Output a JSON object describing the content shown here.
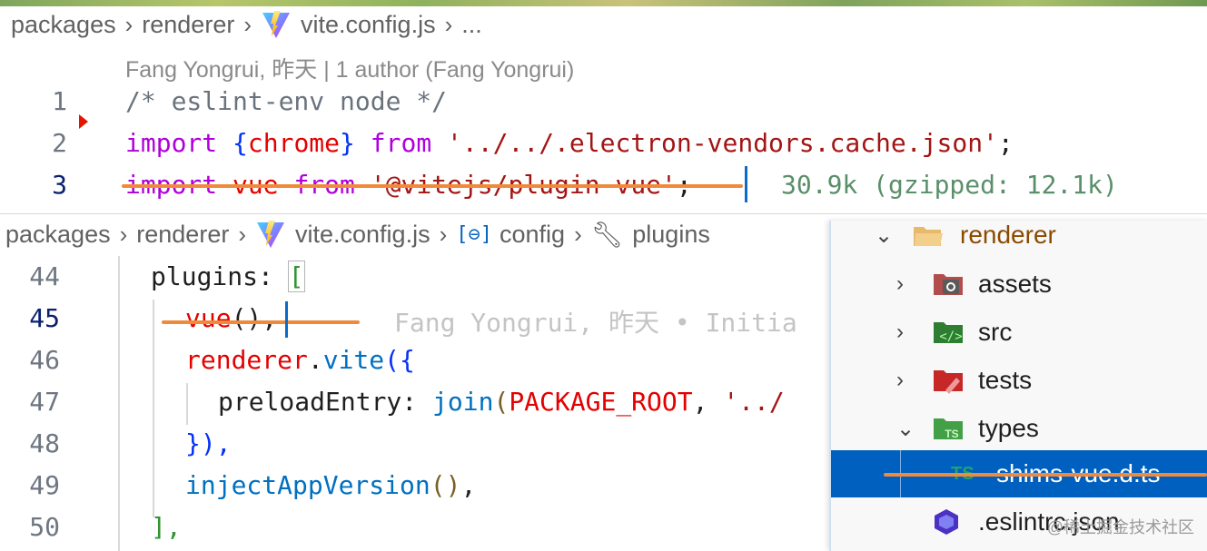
{
  "top_breadcrumb": {
    "items": [
      "packages",
      "renderer",
      "vite.config.js",
      "..."
    ]
  },
  "blame_header": "Fang Yongrui, 昨天 | 1 author (Fang Yongrui)",
  "top_lines": [
    {
      "num": "1",
      "text": "/* eslint-env node */"
    },
    {
      "num": "2",
      "kw1": "import",
      "lb": "{",
      "name": "chrome",
      "rb": "}",
      "kw2": "from",
      "str": "'../../.electron-vendors.cache.json'",
      "semi": ";"
    },
    {
      "num": "3",
      "kw1": "import",
      "name": "vue",
      "kw2": "from",
      "str": "'@vitejs/plugin-vue'",
      "semi": ";",
      "size_hint": "30.9k (gzipped: 12.1k)"
    }
  ],
  "bottom_breadcrumb": {
    "items": [
      "packages",
      "renderer",
      "vite.config.js",
      "config",
      "plugins"
    ]
  },
  "bottom_lines": [
    {
      "num": "44",
      "text": "plugins",
      "colon": ":",
      "bracket": "["
    },
    {
      "num": "45",
      "text": "vue",
      "paren": "()",
      "comma": ",",
      "blame": "Fang Yongrui, 昨天 • Initia"
    },
    {
      "num": "46",
      "obj": "renderer",
      "dot": ".",
      "method": "vite",
      "open": "({"
    },
    {
      "num": "47",
      "prop": "preloadEntry",
      "colon": ":",
      "fn": "join",
      "open": "(",
      "arg": "PACKAGE_ROOT",
      "comma": ",",
      "str": "'../"
    },
    {
      "num": "48",
      "text": "}),"
    },
    {
      "num": "49",
      "fn": "injectAppVersion",
      "paren": "()",
      "comma": ","
    },
    {
      "num": "50",
      "text": "],"
    }
  ],
  "explorer": {
    "items": [
      {
        "label": "renderer",
        "icon": "folder-open-icon",
        "expanded": true
      },
      {
        "label": "assets",
        "icon": "assets-folder-icon",
        "expanded": false
      },
      {
        "label": "src",
        "icon": "src-folder-icon",
        "expanded": false
      },
      {
        "label": "tests",
        "icon": "tests-folder-icon",
        "expanded": false
      },
      {
        "label": "types",
        "icon": "types-folder-icon",
        "expanded": true
      },
      {
        "label": "shims-vue.d.ts",
        "icon": "typescript-file-icon",
        "selected": true
      },
      {
        "label": ".eslintrc.json",
        "icon": "eslint-icon"
      }
    ]
  },
  "watermark": "@稀土掘金技术社区",
  "colors": {
    "keyword": "#af00db",
    "string": "#a31515",
    "strike": "#f08a3a",
    "selection": "#0060c0"
  }
}
